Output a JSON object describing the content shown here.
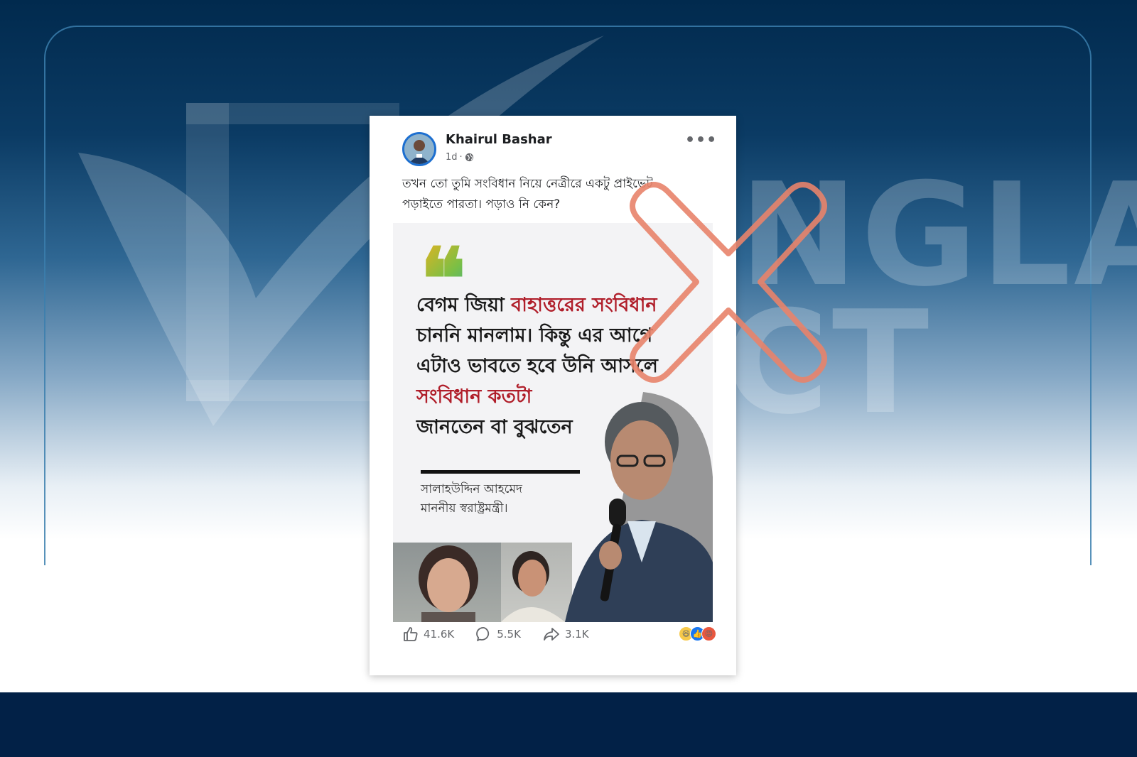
{
  "watermark": {
    "line1": "NGLA",
    "line2": "CT"
  },
  "post": {
    "author": "Khairul Bashar",
    "time": "1d",
    "visibility_icon": "globe-icon",
    "more_label": "•••",
    "caption_line1": "তখন তো তুমি সংবিধান নিয়ে নেত্রীরে একটু প্রাইভেট",
    "caption_line2": "পড়াইতে পারতা। পড়াও নি কেন?"
  },
  "quote_card": {
    "quote_mark": "❝",
    "line1_black": "বেগম জিয়া ",
    "line1_red": "বাহাত্তরের সংবিধান",
    "line2": "চাননি মানলাম। কিন্তু এর আগে",
    "line3": "এটাও ভাবতে হবে উনি আসলে",
    "line4_red": "সংবিধান কতটা",
    "line5": "জানতেন বা বুঝতেন",
    "speaker_name": "সালাহউদ্দিন আহমেদ",
    "speaker_title": "মাননীয় স্বরাষ্ট্রমন্ত্রী।",
    "accent_color": "#b01e2a"
  },
  "engagement": {
    "likes": "41.6K",
    "comments": "5.5K",
    "shares": "3.1K",
    "reactions": [
      "haha",
      "like",
      "angry"
    ]
  },
  "verdict": {
    "icon": "false-x-icon",
    "color": "#e8836a"
  }
}
